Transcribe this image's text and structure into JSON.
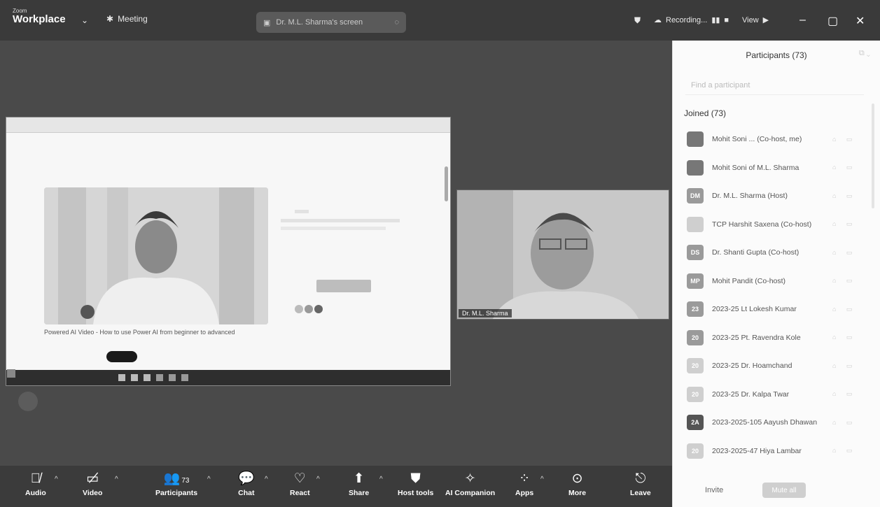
{
  "titlebar": {
    "brand_small": "Zoom",
    "brand_big": "Workplace",
    "meeting_label": "Meeting",
    "share_label": "Dr. M.L. Sharma's screen",
    "recording_label": "Recording...",
    "view_label": "View"
  },
  "participants_panel": {
    "title": "Participants (73)",
    "search_placeholder": "Find a participant",
    "joined_label": "Joined (73)",
    "items": [
      {
        "initials": "",
        "name": "Mohit Soni ... (Co-host, me)",
        "style": "photo"
      },
      {
        "initials": "",
        "name": "Mohit Soni of M.L. Sharma",
        "style": "photo"
      },
      {
        "initials": "DM",
        "name": "Dr. M.L. Sharma (Host)",
        "style": "mid"
      },
      {
        "initials": "",
        "name": "TCP Harshit Saxena (Co-host)",
        "style": "light"
      },
      {
        "initials": "DS",
        "name": "Dr. Shanti Gupta (Co-host)",
        "style": "mid"
      },
      {
        "initials": "MP",
        "name": "Mohit Pandit (Co-host)",
        "style": "mid"
      },
      {
        "initials": "23",
        "name": "2023-25 Lt Lokesh Kumar",
        "style": "mid"
      },
      {
        "initials": "20",
        "name": "2023-25 Pt. Ravendra Kole",
        "style": "mid"
      },
      {
        "initials": "20",
        "name": "2023-25 Dr. Hoamchand",
        "style": "light"
      },
      {
        "initials": "20",
        "name": "2023-25 Dr. Kalpa Twar",
        "style": "light"
      },
      {
        "initials": "2A",
        "name": "2023-2025-105 Aayush Dhawan",
        "style": "dark"
      },
      {
        "initials": "20",
        "name": "2023-2025-47 Hiya Lambar",
        "style": "light"
      }
    ],
    "invite_label": "Invite",
    "mute_all_label": "Mute all"
  },
  "shared_screen": {
    "caption": "Powered AI Video - How to use Power AI from beginner to advanced"
  },
  "participant_video": {
    "name": "Dr. M.L. Sharma"
  },
  "toolbar": {
    "audio": "Audio",
    "video": "Video",
    "participants": "Participants",
    "participants_count": "73",
    "chat": "Chat",
    "react": "React",
    "share": "Share",
    "host_tools": "Host tools",
    "ai_companion": "AI Companion",
    "apps": "Apps",
    "more": "More",
    "leave": "Leave"
  }
}
